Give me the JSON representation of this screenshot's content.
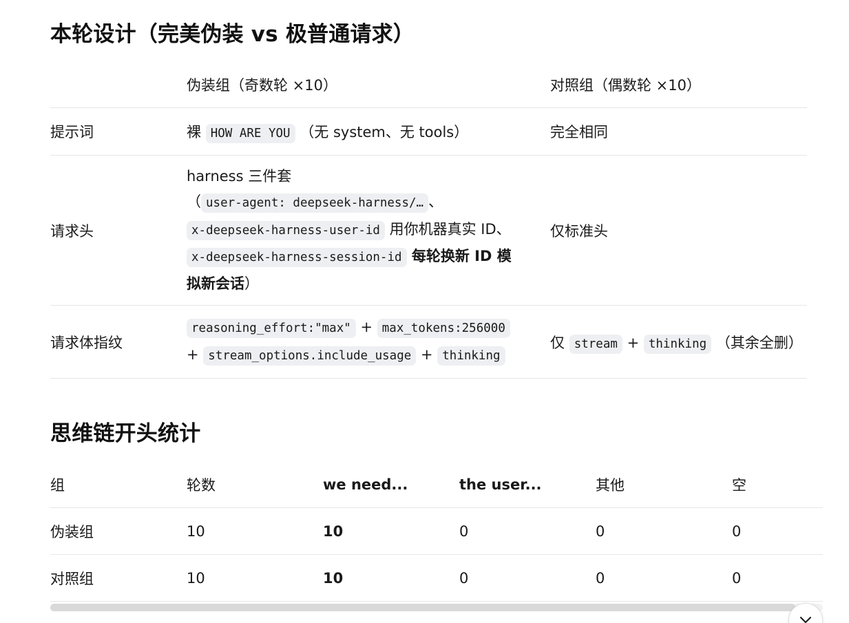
{
  "design": {
    "title": "本轮设计（完美伪装 vs 极普通请求）",
    "header": {
      "col1": "",
      "col2": "伪装组（奇数轮 ×10）",
      "col3": "对照组（偶数轮 ×10）"
    },
    "rows": {
      "prompt": {
        "label": "提示词",
        "a_prefix": "裸 ",
        "a_code": "HOW ARE YOU",
        "a_suffix": " （无 system、无 tools）",
        "b": "完全相同"
      },
      "headers": {
        "label": "请求头",
        "a_text1": "harness 三件套（",
        "a_code1": "user-agent: deepseek-harness/…",
        "a_sep1": "、",
        "a_code2": "x-deepseek-harness-user-id",
        "a_text2": " 用你机器真实 ID、",
        "a_code3": "x-deepseek-harness-session-id",
        "a_bold": " 每轮换新 ID 模拟新会话",
        "a_end": "）",
        "b": "仅标准头"
      },
      "body": {
        "label": "请求体指纹",
        "a_code1": "reasoning_effort:\"max\"",
        "a_plus1": " + ",
        "a_code2": "max_tokens:256000",
        "a_plus2": " + ",
        "a_code3": "stream_options.include_usage",
        "a_plus3": " + ",
        "a_code4": "thinking",
        "b_prefix": "仅 ",
        "b_code1": "stream",
        "b_plus": " + ",
        "b_code2": "thinking",
        "b_suffix": " （其余全删）"
      }
    }
  },
  "stats": {
    "title": "思维链开头统计",
    "columns": [
      "组",
      "轮数",
      "we need...",
      "the user...",
      "其他",
      "空"
    ],
    "rows": [
      {
        "group": "伪装组",
        "rounds": "10",
        "we_need": "10",
        "the_user": "0",
        "other": "0",
        "empty": "0"
      },
      {
        "group": "对照组",
        "rounds": "10",
        "we_need": "10",
        "the_user": "0",
        "other": "0",
        "empty": "0"
      }
    ]
  },
  "icons": {
    "scroll_down": "chevron-down-icon"
  }
}
